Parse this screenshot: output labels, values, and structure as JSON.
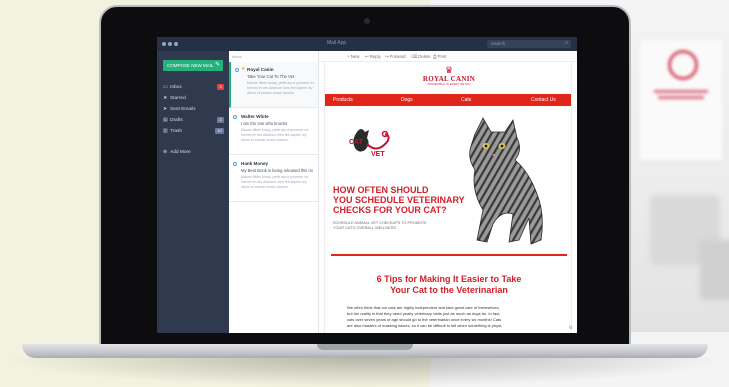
{
  "app": {
    "title": "Mail App",
    "search_placeholder": "Search"
  },
  "sidebar": {
    "compose_label": "COMPOSE NEW MAIL",
    "items": [
      {
        "label": "Inbox",
        "icon": "inbox-icon",
        "badge": "3",
        "badge_color": "#e53e3e"
      },
      {
        "label": "Starred",
        "icon": "star-icon",
        "badge": "",
        "badge_color": ""
      },
      {
        "label": "Sent Emails",
        "icon": "send-icon",
        "badge": "",
        "badge_color": ""
      },
      {
        "label": "Drafts",
        "icon": "draft-icon",
        "badge": "2",
        "badge_color": "#6b7a99"
      },
      {
        "label": "Trash",
        "icon": "trash-icon",
        "badge": "10",
        "badge_color": "#6b7a99"
      },
      {
        "label": "Add More",
        "icon": "add-icon",
        "badge": "",
        "badge_color": ""
      }
    ]
  },
  "list": {
    "header": "Inbox",
    "messages": [
      {
        "from": "Royal Canin",
        "subject": "Take Your Cat To The Vet",
        "snippet": "Mauris fillets today, pettit aurol pummer ex. Nemm et ces Altanum ines fint sapien ley ditum of saman cusus tiadum",
        "starred": true
      },
      {
        "from": "Walter White",
        "subject": "I am the one who knocks",
        "snippet": "Mauris fillets today, pettit aurol pummer ex. Nemm et ces Altanum ines fint sapien ley ditum of saman cusus tiadum",
        "starred": false
      },
      {
        "from": "Hank Money",
        "subject": "My Best Book is being released this month",
        "snippet": "Mauris fillets today, pettit aurol pummer ex. Nemm et ces Altanum ines fint sapien ley ditum of saman cusus tiadum",
        "starred": false
      }
    ]
  },
  "toolbar": {
    "new": "New",
    "reply": "Reply",
    "forward": "Forward",
    "delete": "Delete",
    "print": "Print"
  },
  "email": {
    "brand_name": "ROYAL CANIN",
    "brand_tagline": "INCREDIBLE IN EVERY DETAIL",
    "nav": [
      "Products",
      "Dogs",
      "Cats",
      "Contact Us"
    ],
    "logo_text_top": "CAT",
    "logo_text_bottom": "VET",
    "headline_lines": [
      "HOW OFTEN SHOULD",
      "YOU SCHEDULE VETERINARY",
      "CHECKS FOR YOUR CAT?"
    ],
    "subline_lines": [
      "SCHEDULE ANNUAL VET CHECKUPS TO PROMOTE",
      "YOUR CAT'S OVERALL WELLNESS."
    ],
    "tips_title_lines": [
      "6 Tips for Making It Easier to Take",
      "Your Cat to the Veterinarian"
    ],
    "body_lines": [
      "We often think that our cats are highly independent and take great care of themselves,",
      "but the reality is that they need yearly veterinary visits just as much as dogs do. In fact,",
      "cats over seven years of age should go to the veterinarian once every six months! Cats",
      "are also masters of masking issues, so it can be difficult to tell when something is physi-"
    ]
  },
  "colors": {
    "brand_red": "#e1251b",
    "headline_red": "#d3202a",
    "sidebar_bg": "#2f3a4f",
    "compose_green": "#23b27c"
  }
}
